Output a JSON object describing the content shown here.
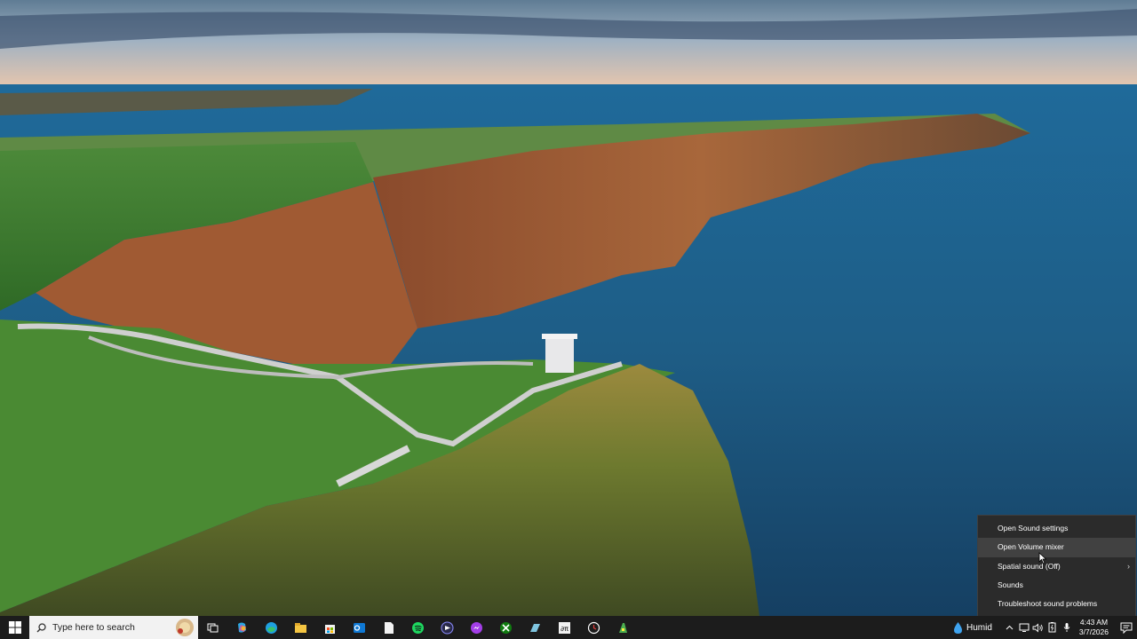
{
  "context_menu": {
    "items": [
      {
        "label": "Open Sound settings"
      },
      {
        "label": "Open Volume mixer"
      },
      {
        "label": "Spatial sound (Off)",
        "submenu_arrow": "›"
      },
      {
        "label": "Sounds"
      },
      {
        "label": "Troubleshoot sound problems"
      }
    ],
    "hovered_item": "Open Volume mixer"
  },
  "taskbar": {
    "search_placeholder": "Type here to search",
    "pinned_icons": [
      "task-view-icon",
      "copilot-icon",
      "edge-icon",
      "file-explorer-icon",
      "microsoft-store-icon",
      "outlook-icon",
      "notepad-icon",
      "spotify-icon",
      "media-player-icon",
      "messenger-icon",
      "xbox-icon",
      "paint-icon",
      "math-app-icon",
      "clock-app-icon",
      "green-app-icon"
    ],
    "weather": {
      "label": "Humid",
      "icon": "droplet-icon"
    },
    "tray_icons": [
      "chevron-up-icon",
      "network-icon",
      "volume-icon",
      "battery-icon",
      "microphone-icon"
    ],
    "clock": {
      "time": "4:43 AM",
      "date": "3/7/2026"
    }
  }
}
